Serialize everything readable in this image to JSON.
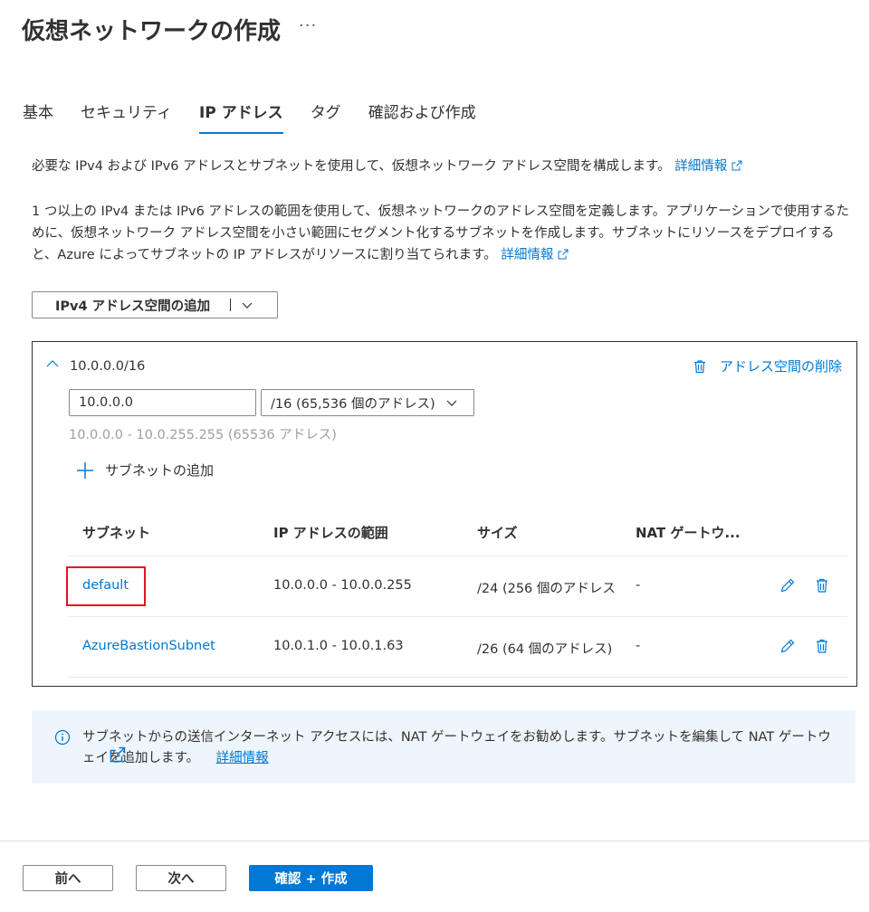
{
  "header": {
    "title": "仮想ネットワークの作成",
    "more": "···"
  },
  "tabs": [
    {
      "label": "基本",
      "active": false
    },
    {
      "label": "セキュリティ",
      "active": false
    },
    {
      "label": "IP アドレス",
      "active": true
    },
    {
      "label": "タグ",
      "active": false
    },
    {
      "label": "確認および作成",
      "active": false
    }
  ],
  "description": {
    "line1": "必要な IPv4 および IPv6 アドレスとサブネットを使用して、仮想ネットワーク アドレス空間を構成します。",
    "line1_link": "詳細情報",
    "para2": "1 つ以上の IPv4 または IPv6 アドレスの範囲を使用して、仮想ネットワークのアドレス空間を定義します。アプリケーションで使用するために、仮想ネットワーク アドレス空間を小さい範囲にセグメント化するサブネットを作成します。サブネットにリソースをデプロイすると、Azure によってサブネットの IP アドレスがリソースに割り当てられます。",
    "para2_link": "詳細情報"
  },
  "add_address_space": {
    "label": "IPv4 アドレス空間の追加"
  },
  "address_space": {
    "cidr": "10.0.0.0/16",
    "delete_label": "アドレス空間の削除",
    "ip_value": "10.0.0.0",
    "prefix_selected": "/16 (65,536 個のアドレス)",
    "range_hint": "10.0.0.0 - 10.0.255.255 (65536 アドレス)",
    "add_subnet_label": "サブネットの追加"
  },
  "subnet_table": {
    "columns": [
      "サブネット",
      "IP アドレスの範囲",
      "サイズ",
      "NAT ゲートウ..."
    ],
    "rows": [
      {
        "name": "default",
        "range": "10.0.0.0 - 10.0.0.255",
        "size": "/24 (256 個のアドレス",
        "nat": "-"
      },
      {
        "name": "AzureBastionSubnet",
        "range": "10.0.1.0 - 10.0.1.63",
        "size": "/26 (64 個のアドレス)",
        "nat": "-"
      }
    ]
  },
  "info_banner": {
    "text": "サブネットからの送信インターネット アクセスには、NAT ゲートウェイをお勧めします。サブネットを編集して NAT ゲートウェイを追加します。",
    "link": "詳細情報"
  },
  "footer": {
    "prev": "前へ",
    "next": "次へ",
    "create": "確認 + 作成"
  },
  "colors": {
    "accent": "#0078d4",
    "highlight": "#e81123",
    "info_bg": "#eef5fc"
  }
}
